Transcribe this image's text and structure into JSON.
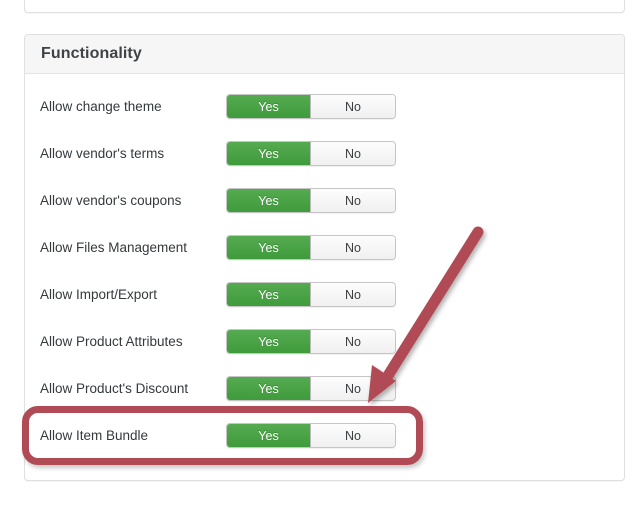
{
  "panel": {
    "title": "Functionality",
    "rows": [
      {
        "label": "Allow change theme",
        "yes": "Yes",
        "no": "No",
        "selected": "Yes"
      },
      {
        "label": "Allow vendor's terms",
        "yes": "Yes",
        "no": "No",
        "selected": "Yes"
      },
      {
        "label": "Allow vendor's coupons",
        "yes": "Yes",
        "no": "No",
        "selected": "Yes"
      },
      {
        "label": "Allow Files Management",
        "yes": "Yes",
        "no": "No",
        "selected": "Yes"
      },
      {
        "label": "Allow Import/Export",
        "yes": "Yes",
        "no": "No",
        "selected": "Yes"
      },
      {
        "label": "Allow Product Attributes",
        "yes": "Yes",
        "no": "No",
        "selected": "Yes"
      },
      {
        "label": "Allow Product's Discount",
        "yes": "Yes",
        "no": "No",
        "selected": "Yes"
      },
      {
        "label": "Allow Item Bundle",
        "yes": "Yes",
        "no": "No",
        "selected": "Yes"
      }
    ]
  },
  "annotations": {
    "highlight": {
      "target_row_label": "Allow Item Bundle",
      "color": "#b04b56"
    },
    "arrow": {
      "color": "#b04b56",
      "points_to": "Allow Item Bundle"
    }
  },
  "colors": {
    "toggle_yes_green": "#45a145",
    "toggle_no_grey": "#f2f2f2",
    "panel_heading_bg": "#f6f6f6",
    "panel_border": "#e0e0e0",
    "annotation_red": "#b04b56",
    "label_text": "#34393d",
    "title_text": "#3f4347"
  }
}
